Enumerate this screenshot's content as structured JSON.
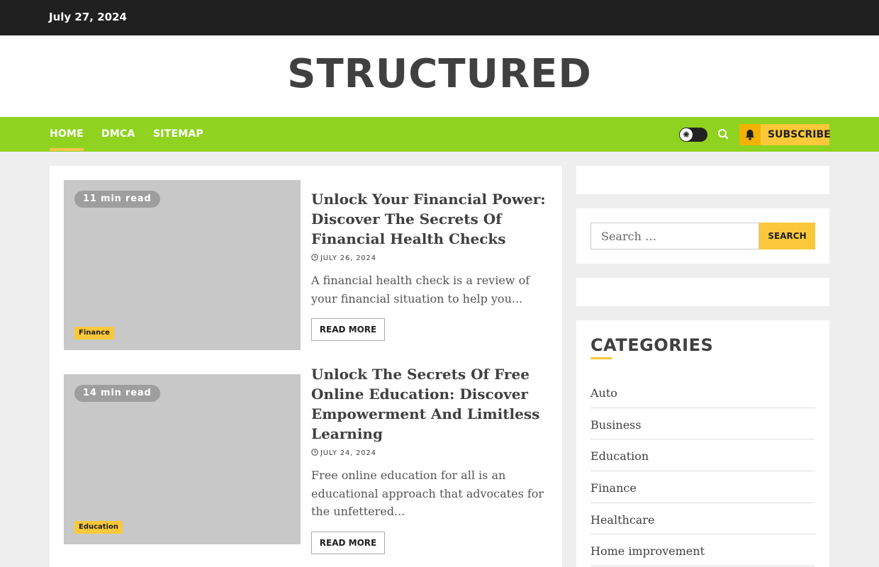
{
  "topbar": {
    "date": "July 27, 2024"
  },
  "site": {
    "title": "STRUCTURED"
  },
  "nav": {
    "items": [
      {
        "label": "Home",
        "active": true
      },
      {
        "label": "DMCA",
        "active": false
      },
      {
        "label": "Sitemap",
        "active": false
      }
    ],
    "subscribe_label": "Subscribe",
    "icons": {
      "theme_toggle": "sun-icon",
      "search": "search-icon",
      "subscribe": "bell-icon"
    }
  },
  "posts": [
    {
      "read_time": "11 min read",
      "category": "Finance",
      "title": "Unlock Your Financial Power: Discover The Secrets Of Financial Health Checks",
      "date": "July 26, 2024",
      "excerpt": "A financial health check is a review of your financial situation to help you...",
      "read_more": "Read More"
    },
    {
      "read_time": "14 min read",
      "category": "Education",
      "title": "Unlock The Secrets Of Free Online Education: Discover Empowerment And Limitless Learning",
      "date": "July 24, 2024",
      "excerpt": "Free online education for all is an educational approach that advocates for the unfettered...",
      "read_more": "Read More"
    }
  ],
  "sidebar": {
    "search": {
      "placeholder": "Search …",
      "button_label": "Search"
    },
    "categories": {
      "title": "Categories",
      "items": [
        "Auto",
        "Business",
        "Education",
        "Finance",
        "Healthcare",
        "Home improvement"
      ]
    }
  },
  "colors": {
    "topbar": "#202020",
    "nav": "#8fd320",
    "accent": "#fbc83a",
    "thumbnail": "#c8c8c8",
    "page_bg": "#eeeeee"
  }
}
